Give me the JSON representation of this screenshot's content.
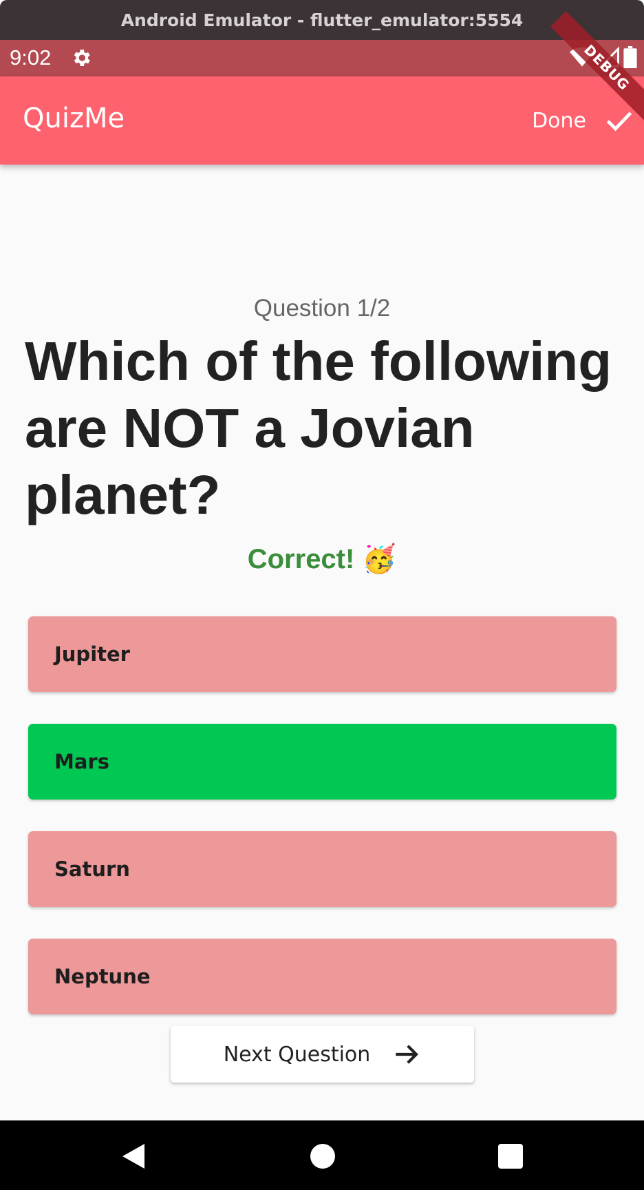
{
  "window": {
    "title": "Android Emulator - flutter_emulator:5554"
  },
  "status_bar": {
    "time": "9:02",
    "icons": [
      "gear-icon",
      "wifi-icon",
      "signal-icon",
      "battery-icon"
    ]
  },
  "app_bar": {
    "title": "QuizMe",
    "done_label": "Done",
    "done_icon": "check-icon",
    "color": "#fe626e",
    "debug_banner": "DEBUG"
  },
  "quiz": {
    "counter": "Question 1/2",
    "question": "Which of the following are NOT a Jovian planet?",
    "feedback": "Correct! 🥳",
    "feedback_color": "#3a8d3a",
    "options": [
      {
        "label": "Jupiter",
        "state": "incorrect",
        "color": "#ed9899"
      },
      {
        "label": "Mars",
        "state": "correct",
        "color": "#00c853"
      },
      {
        "label": "Saturn",
        "state": "incorrect",
        "color": "#ed9899"
      },
      {
        "label": "Neptune",
        "state": "incorrect",
        "color": "#ed9899"
      }
    ],
    "next_label": "Next Question",
    "next_icon": "arrow-right-icon"
  },
  "nav_bar": {
    "icons": [
      "back-icon",
      "home-icon",
      "recents-icon"
    ]
  }
}
